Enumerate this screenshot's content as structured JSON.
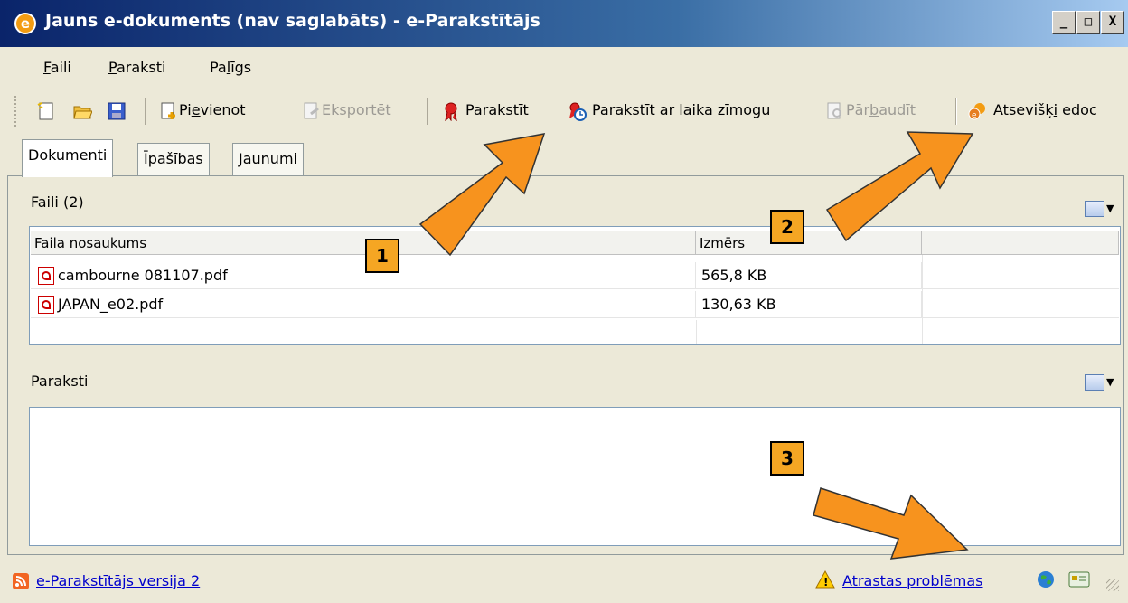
{
  "window": {
    "title": "Jauns e-dokuments (nav saglabāts) - e-Parakstītājs",
    "app_icon_glyph": "e",
    "controls": {
      "minimize": "_",
      "maximize": "□",
      "close": "X"
    }
  },
  "menu": {
    "items": [
      {
        "label": "Faili",
        "accel": "F",
        "rest": "aili"
      },
      {
        "label": "Paraksti",
        "accel": "P",
        "rest": "araksti"
      },
      {
        "label": "Palīgs",
        "pre": "Pa",
        "accel": "l",
        "rest": "īgs"
      }
    ]
  },
  "toolbar": {
    "new_icon": "new-document-icon",
    "open_icon": "folder-open-icon",
    "save_icon": "save-disk-icon",
    "add": {
      "pre": "Pi",
      "accel": "e",
      "rest": "vienot"
    },
    "export": "Eksportēt",
    "sign": "Parakstīt",
    "sign_timestamp": "Parakstīt ar laika zīmogu",
    "verify": {
      "pre": "Pār",
      "accel": "b",
      "rest": "audīt"
    },
    "separate": {
      "pre": "Atsevišķ",
      "accel": "i",
      "rest": " edoc"
    }
  },
  "tabs": [
    {
      "label": "Dokumenti",
      "active": true
    },
    {
      "label": "Īpašības",
      "active": false
    },
    {
      "label": "Jaunumi",
      "active": false
    }
  ],
  "files_section": {
    "label": "Faili (2)",
    "columns": [
      "Faila nosaukums",
      "Izmērs",
      ""
    ],
    "rows": [
      {
        "name": "cambourne  081107.pdf",
        "size": "565,8 KB"
      },
      {
        "name": "JAPAN_e02.pdf",
        "size": "130,63 KB"
      }
    ]
  },
  "signatures_section": {
    "label": "Paraksti"
  },
  "status": {
    "version_link": "e-Parakstītājs versija 2",
    "problems_link": "Atrastas problēmas"
  },
  "annotations": {
    "callouts": [
      "1",
      "2",
      "3"
    ]
  },
  "colors": {
    "callout": "#f5a623",
    "arrow": "#f7931e",
    "title_gradient_start": "#0a246a"
  }
}
